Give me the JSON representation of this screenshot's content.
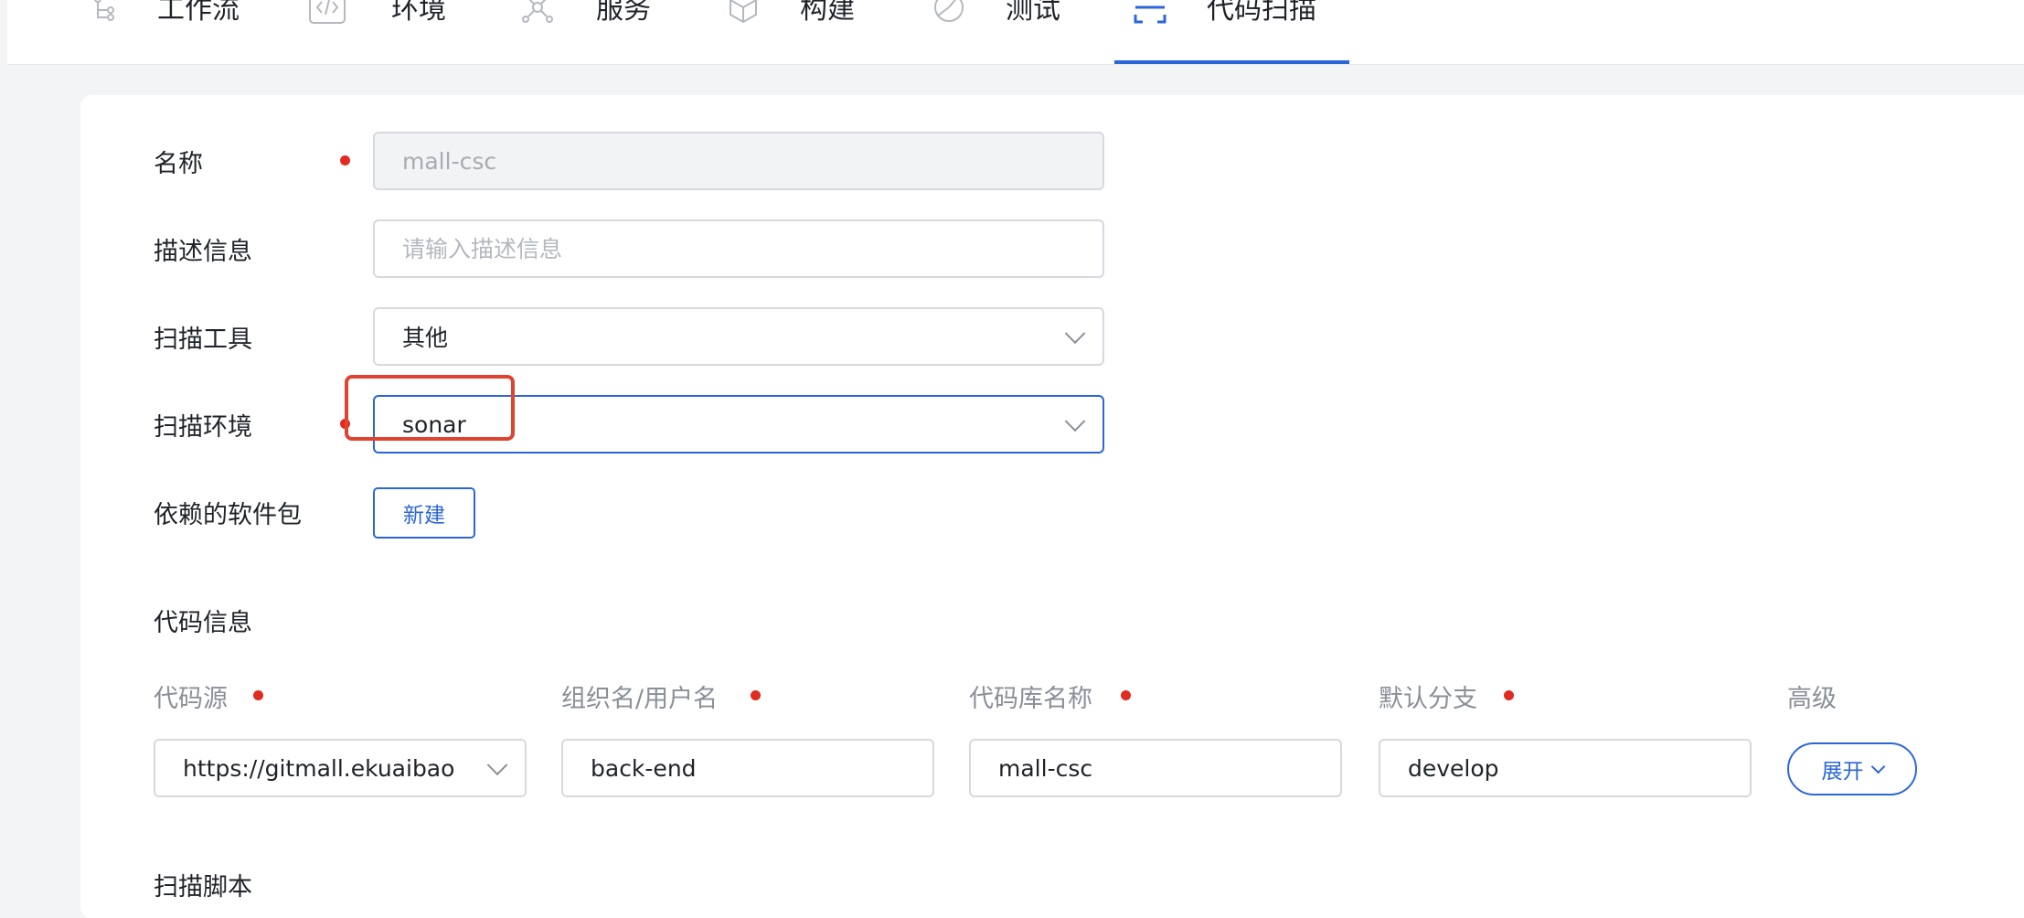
{
  "nav": {
    "tabs": [
      {
        "label": "工作流",
        "icon": "workflow-icon"
      },
      {
        "label": "环境",
        "icon": "code-icon"
      },
      {
        "label": "服务",
        "icon": "network-icon"
      },
      {
        "label": "构建",
        "icon": "cube-icon"
      },
      {
        "label": "测试",
        "icon": "pie-icon"
      },
      {
        "label": "代码扫描",
        "icon": "scan-icon",
        "active": true
      }
    ]
  },
  "form": {
    "name": {
      "label": "名称",
      "value": "mall-csc",
      "required": true,
      "disabled": true
    },
    "description": {
      "label": "描述信息",
      "placeholder": "请输入描述信息"
    },
    "scan_tool": {
      "label": "扫描工具",
      "value": "其他"
    },
    "scan_env": {
      "label": "扫描环境",
      "value": "sonar",
      "required": true
    },
    "dependencies": {
      "label": "依赖的软件包",
      "new_button": "新建"
    }
  },
  "code_info": {
    "title": "代码信息",
    "columns": {
      "source": {
        "label": "代码源",
        "value": "https://gitmall.ekuaibao"
      },
      "org": {
        "label": "组织名/用户名",
        "value": "back-end"
      },
      "repo": {
        "label": "代码库名称",
        "value": "mall-csc"
      },
      "branch": {
        "label": "默认分支",
        "value": "develop"
      },
      "advanced": {
        "label": "高级",
        "button": "展开"
      }
    }
  },
  "scan_script": {
    "title": "扫描脚本"
  },
  "colors": {
    "accent": "#2b66d9",
    "required": "#e02b20",
    "highlight": "#e0432f"
  }
}
